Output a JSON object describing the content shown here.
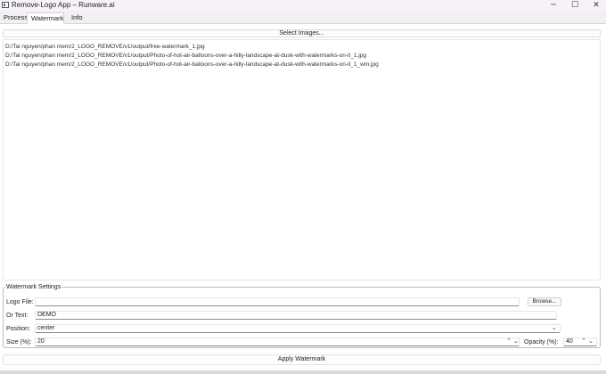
{
  "window": {
    "title": "Remove-Logo App – Runware.ai",
    "minimize_glyph": "─",
    "maximize_glyph": "☐",
    "close_glyph": "✕"
  },
  "tabs": {
    "process": "Process",
    "watermark": "Watermark",
    "info": "Info",
    "active": "Watermark"
  },
  "select_images_label": "Select Images...",
  "files": [
    "D:/Tai nguyen/phan mem/2_LOGO_REMOVE/v1/output/free-watermark_1.jpg",
    "D:/Tai nguyen/phan mem/2_LOGO_REMOVE/v1/output/Photo-of-hot-air-balloons-over-a-hilly-landscape-at-dusk-with-watermarks-on-it_1.jpg",
    "D:/Tai nguyen/phan mem/2_LOGO_REMOVE/v1/output/Photo-of-hot-air-balloons-over-a-hilly-landscape-at-dusk-with-watermarks-on-it_1_wm.jpg"
  ],
  "settings": {
    "group_title": "Watermark Settings",
    "logo_file_label": "Logo File:",
    "logo_file_value": "",
    "browse_label": "Browse...",
    "or_text_label": "Or Text:",
    "or_text_value": "DEMO",
    "position_label": "Position:",
    "position_value": "center",
    "size_label": "Size (%):",
    "size_value": "20",
    "opacity_label": "Opacity (%):",
    "opacity_value": "40"
  },
  "apply_label": "Apply Watermark"
}
